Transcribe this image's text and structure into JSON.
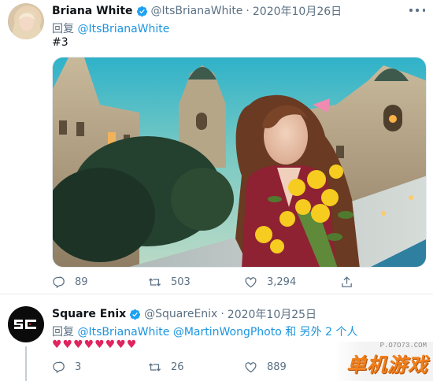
{
  "tweets": [
    {
      "author": {
        "name": "Briana White",
        "handle": "@ItsBrianaWhite",
        "verified": true
      },
      "dot": "·",
      "date": "2020年10月26日",
      "reply_prefix": "回复 ",
      "reply_mentions": [
        "@ItsBrianaWhite"
      ],
      "text": "#3",
      "has_photo": true,
      "actions": {
        "replies": "89",
        "retweets": "503",
        "likes": "3,294"
      }
    },
    {
      "author": {
        "name": "Square Enix",
        "handle": "@SquareEnix",
        "verified": true
      },
      "dot": "·",
      "date": "2020年10月25日",
      "reply_prefix": "回复 ",
      "reply_mentions": [
        "@ItsBrianaWhite",
        "@MartinWongPhoto"
      ],
      "reply_suffix": " 和 另外 2 个人",
      "text": "♥♥♥♥♥♥♥♥",
      "actions": {
        "replies": "3",
        "retweets": "26",
        "likes": "889"
      }
    }
  ],
  "icons": {
    "verified": "verified-badge-icon",
    "more": "more-icon",
    "reply": "reply-icon",
    "retweet": "retweet-icon",
    "like": "like-icon",
    "share": "share-icon"
  },
  "colors": {
    "verified": "#1da1f2",
    "mention": "#1b95e0",
    "muted": "#5b7083",
    "heart": "#e0245e",
    "watermark": "#f07f1a"
  },
  "watermark": {
    "site": "P.O7O73.COM",
    "logo": "单机游戏"
  }
}
